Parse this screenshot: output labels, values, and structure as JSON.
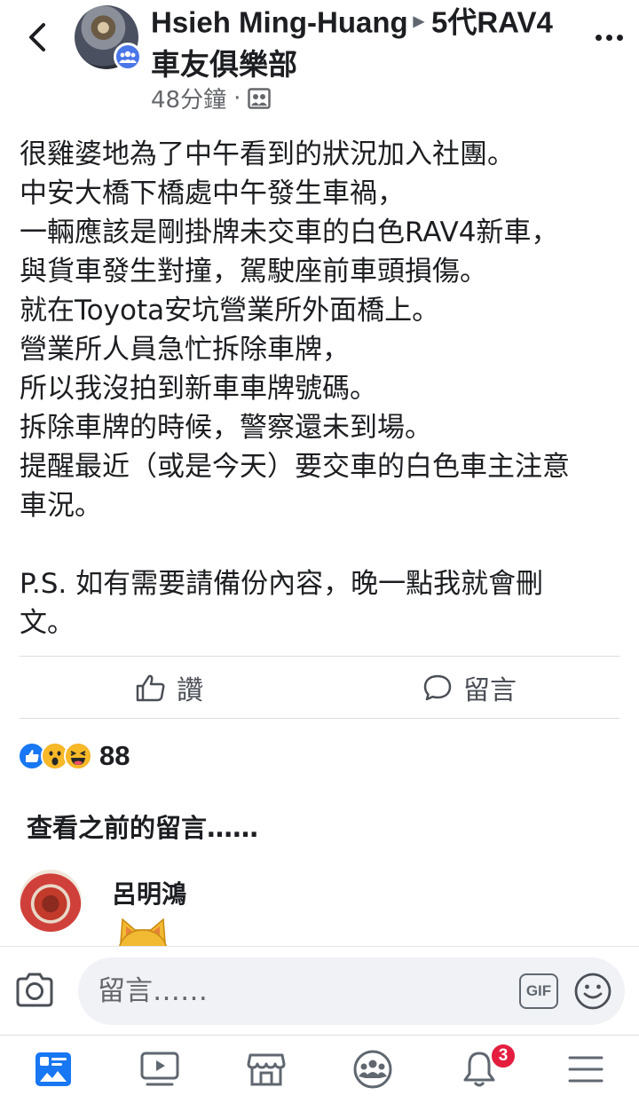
{
  "header": {
    "author": "Hsieh Ming-Huang",
    "group_line1": "5代RAV4",
    "group_line2": "車友俱樂部",
    "timestamp": "48分鐘",
    "separator": "·"
  },
  "post": {
    "body": "很雞婆地為了中午看到的狀況加入社團。\n中安大橋下橋處中午發生車禍，\n一輛應該是剛掛牌未交車的白色RAV4新車，\n與貨車發生對撞，駕駛座前車頭損傷。\n就在Toyota安坑營業所外面橋上。\n營業所人員急忙拆除車牌，\n所以我沒拍到新車車牌號碼。\n拆除車牌的時候，警察還未到場。\n提醒最近（或是今天）要交車的白色車主注意\n車況。\n\nP.S. 如有需要請備份內容，晚一點我就會刪\n文。"
  },
  "actions": {
    "like_label": "讚",
    "comment_label": "留言"
  },
  "reactions": {
    "icons": [
      "like-icon",
      "wow-icon",
      "haha-icon"
    ],
    "count": "88"
  },
  "comments": {
    "view_previous": "查看之前的留言……",
    "items": [
      {
        "author": "呂明鴻",
        "content_icon": "cat-emoji"
      }
    ]
  },
  "composer": {
    "placeholder": "留言……",
    "gif_label": "GIF"
  },
  "bottom_nav": {
    "items": [
      "news-feed-icon",
      "watch-icon",
      "marketplace-icon",
      "groups-icon",
      "notifications-icon",
      "menu-icon"
    ],
    "notification_count": "3"
  },
  "colors": {
    "accent": "#1877f2",
    "badge": "#e41e3f",
    "text_secondary": "#65676b"
  }
}
